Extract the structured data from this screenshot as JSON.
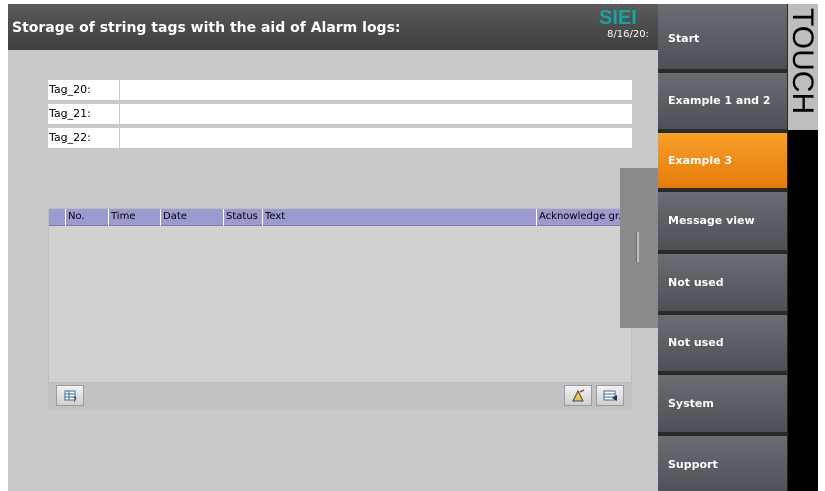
{
  "header": {
    "title": "Storage of string tags with the aid of Alarm logs:",
    "logo": "SIEI",
    "date": "8/16/20:"
  },
  "tags": [
    {
      "label": "Tag_20:",
      "value": ""
    },
    {
      "label": "Tag_21:",
      "value": ""
    },
    {
      "label": "Tag_22:",
      "value": ""
    }
  ],
  "alarm_view": {
    "columns": [
      "No.",
      "Time",
      "Date",
      "Status",
      "Text",
      "Acknowledge gr."
    ],
    "rows": []
  },
  "nav": {
    "items": [
      {
        "label": "Start",
        "active": false
      },
      {
        "label": "Example 1 and 2",
        "active": false
      },
      {
        "label": "Example 3",
        "active": true
      },
      {
        "label": "Message view",
        "active": false
      },
      {
        "label": "Not used",
        "active": false
      },
      {
        "label": "Not used",
        "active": false
      },
      {
        "label": "System",
        "active": false
      },
      {
        "label": "Support",
        "active": false
      }
    ]
  },
  "side_label": "TOUCH",
  "colors": {
    "accent": "#f7a02a",
    "header_bg": "#4a4a4a",
    "alarm_header": "#9b9bd0",
    "logo": "#19a3a3"
  }
}
